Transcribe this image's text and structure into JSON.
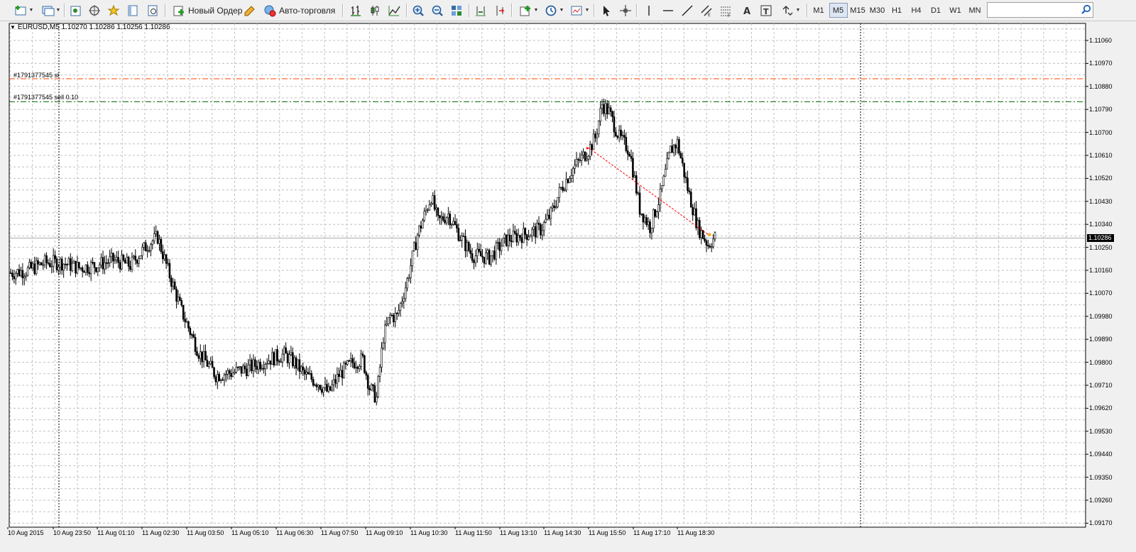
{
  "toolbar": {
    "new_order_label": "Новый Ордер",
    "auto_trading_label": "Авто-торговля",
    "timeframes": [
      {
        "label": "M1",
        "active": false
      },
      {
        "label": "M5",
        "active": true
      },
      {
        "label": "M15",
        "active": false
      },
      {
        "label": "M30",
        "active": false
      },
      {
        "label": "H1",
        "active": false
      },
      {
        "label": "H4",
        "active": false
      },
      {
        "label": "D1",
        "active": false
      },
      {
        "label": "W1",
        "active": false
      },
      {
        "label": "MN",
        "active": false
      }
    ],
    "search_value": "",
    "icons": [
      "new-chart-icon",
      "profiles-icon",
      "market-watch-icon",
      "data-window-icon",
      "navigator-icon",
      "terminal-icon",
      "strategy-tester-icon",
      "new-order-icon",
      "metaeditor-icon",
      "auto-trading-icon",
      "bar-chart-icon",
      "candlestick-icon",
      "line-chart-icon",
      "zoom-in-icon",
      "zoom-out-icon",
      "tile-windows-icon",
      "chart-shift-icon",
      "auto-scroll-icon",
      "indicators-icon",
      "periods-icon",
      "templates-icon",
      "cursor-icon",
      "crosshair-icon",
      "vertical-line-icon",
      "horizontal-line-icon",
      "trend-line-icon",
      "equidistant-channel-icon",
      "fibonacci-icon",
      "text-icon",
      "text-label-icon",
      "arrows-icon",
      "search-icon"
    ]
  },
  "chart": {
    "title": "EURUSD,M5  1.10270 1.10286 1.10256 1.10286",
    "order_labels": {
      "sl": "#1791377545 sl",
      "sell": "#1791377545 sell 0.10"
    },
    "current_price": "1.10286",
    "colors": {
      "background": "#ffffff",
      "grid": "#c0c0c0",
      "bull_body": "#ffffff",
      "bear_body": "#000000",
      "candle_outline": "#000000",
      "sl_line": "#ff4500",
      "order_line": "#006400",
      "trade_line": "#ff0000"
    }
  },
  "chart_data": {
    "type": "candlestick",
    "symbol": "EURUSD",
    "timeframe": "M5",
    "last_bar": {
      "open": 1.1027,
      "high": 1.10286,
      "low": 1.10256,
      "close": 1.10286
    },
    "price_ticks": [
      "1.11060",
      "1.10970",
      "1.10880",
      "1.10790",
      "1.10700",
      "1.10610",
      "1.10520",
      "1.10430",
      "1.10340",
      "1.10250",
      "1.10160",
      "1.10070",
      "1.09980",
      "1.09890",
      "1.09800",
      "1.09710",
      "1.09620",
      "1.09530",
      "1.09440",
      "1.09350",
      "1.09260",
      "1.09170"
    ],
    "time_ticks": [
      "10 Aug 2015",
      "10 Aug 23:50",
      "11 Aug 01:10",
      "11 Aug 02:30",
      "11 Aug 03:50",
      "11 Aug 05:10",
      "11 Aug 06:30",
      "11 Aug 07:50",
      "11 Aug 09:10",
      "11 Aug 10:30",
      "11 Aug 11:50",
      "11 Aug 13:10",
      "11 Aug 14:30",
      "11 Aug 15:50",
      "11 Aug 17:10",
      "11 Aug 18:30"
    ],
    "ylim": [
      1.0915,
      1.1113
    ],
    "close_path": [
      [
        0,
        1.1015
      ],
      [
        10,
        1.1016
      ],
      [
        20,
        1.1019
      ],
      [
        30,
        1.1019
      ],
      [
        40,
        1.1017
      ],
      [
        50,
        1.1018
      ],
      [
        60,
        1.102
      ],
      [
        70,
        1.1018
      ],
      [
        80,
        1.1026
      ],
      [
        86,
        1.1029
      ],
      [
        92,
        1.1016
      ],
      [
        100,
        1.1
      ],
      [
        110,
        1.0984
      ],
      [
        120,
        1.0975
      ],
      [
        130,
        1.0976
      ],
      [
        140,
        1.0978
      ],
      [
        150,
        1.0981
      ],
      [
        160,
        1.0983
      ],
      [
        166,
        1.098
      ],
      [
        172,
        1.0975
      ],
      [
        180,
        1.0972
      ],
      [
        186,
        1.0968
      ],
      [
        192,
        1.0975
      ],
      [
        200,
        1.098
      ],
      [
        206,
        1.0981
      ],
      [
        210,
        1.097
      ],
      [
        214,
        1.0966
      ],
      [
        218,
        1.099
      ],
      [
        222,
        1.0998
      ],
      [
        226,
        1.0998
      ],
      [
        232,
        1.1012
      ],
      [
        238,
        1.103
      ],
      [
        246,
        1.1045
      ],
      [
        250,
        1.1035
      ],
      [
        256,
        1.1038
      ],
      [
        264,
        1.1028
      ],
      [
        270,
        1.1022
      ],
      [
        280,
        1.1021
      ],
      [
        290,
        1.1028
      ],
      [
        300,
        1.103
      ],
      [
        310,
        1.1032
      ],
      [
        316,
        1.1038
      ],
      [
        322,
        1.1048
      ],
      [
        328,
        1.1055
      ],
      [
        334,
        1.106
      ],
      [
        338,
        1.1063
      ],
      [
        342,
        1.1068
      ],
      [
        346,
        1.1081
      ],
      [
        350,
        1.1078
      ],
      [
        356,
        1.1068
      ],
      [
        362,
        1.1063
      ],
      [
        368,
        1.104
      ],
      [
        374,
        1.1033
      ],
      [
        380,
        1.1045
      ],
      [
        386,
        1.1063
      ],
      [
        390,
        1.1066
      ],
      [
        396,
        1.1048
      ],
      [
        402,
        1.1033
      ],
      [
        408,
        1.1026
      ],
      [
        412,
        1.1029
      ]
    ],
    "series": [
      {
        "name": "",
        "values": []
      }
    ],
    "trade": {
      "type": "sell",
      "volume": 0.1,
      "open_price": 1.1064,
      "close_price": 1.103,
      "sl": 1.1091
    },
    "grid": true
  }
}
